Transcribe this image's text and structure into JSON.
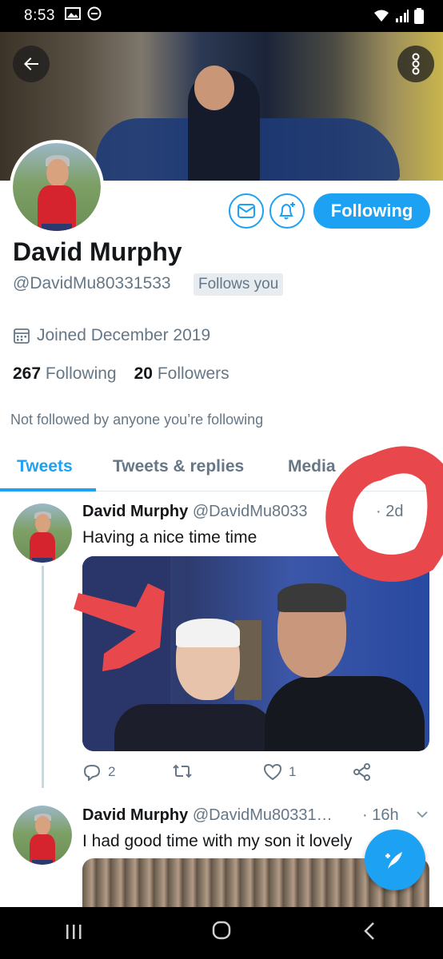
{
  "status": {
    "time": "8:53"
  },
  "profile": {
    "name": "David Murphy",
    "handle": "@DavidMu80331533",
    "follows_you": "Follows you",
    "joined": "Joined December 2019",
    "following_count": "267",
    "following_label": "Following",
    "followers_count": "20",
    "followers_label": "Followers",
    "not_followed": "Not followed by anyone you’re following",
    "follow_button": "Following"
  },
  "tabs": [
    {
      "label": "Tweets"
    },
    {
      "label": "Tweets & replies"
    },
    {
      "label": "Media"
    }
  ],
  "tweets": [
    {
      "name": "David Murphy",
      "handle": "@DavidMu8033",
      "time": "· 2d",
      "text": "Having a nice time time",
      "replies": "2",
      "likes": "1"
    },
    {
      "name": "David Murphy",
      "handle": "@DavidMu80331…",
      "time": "· 16h",
      "text": "I had good time with my son it lovely"
    }
  ],
  "colors": {
    "accent": "#1da1f2",
    "annotation": "#e8484b"
  },
  "icons": {
    "back": "arrow-left-icon",
    "more": "more-vertical-icon",
    "mail": "envelope-icon",
    "notify": "bell-plus-icon",
    "calendar": "calendar-icon",
    "reply": "reply-icon",
    "retweet": "retweet-icon",
    "like": "heart-icon",
    "share": "share-icon",
    "compose": "compose-icon"
  }
}
